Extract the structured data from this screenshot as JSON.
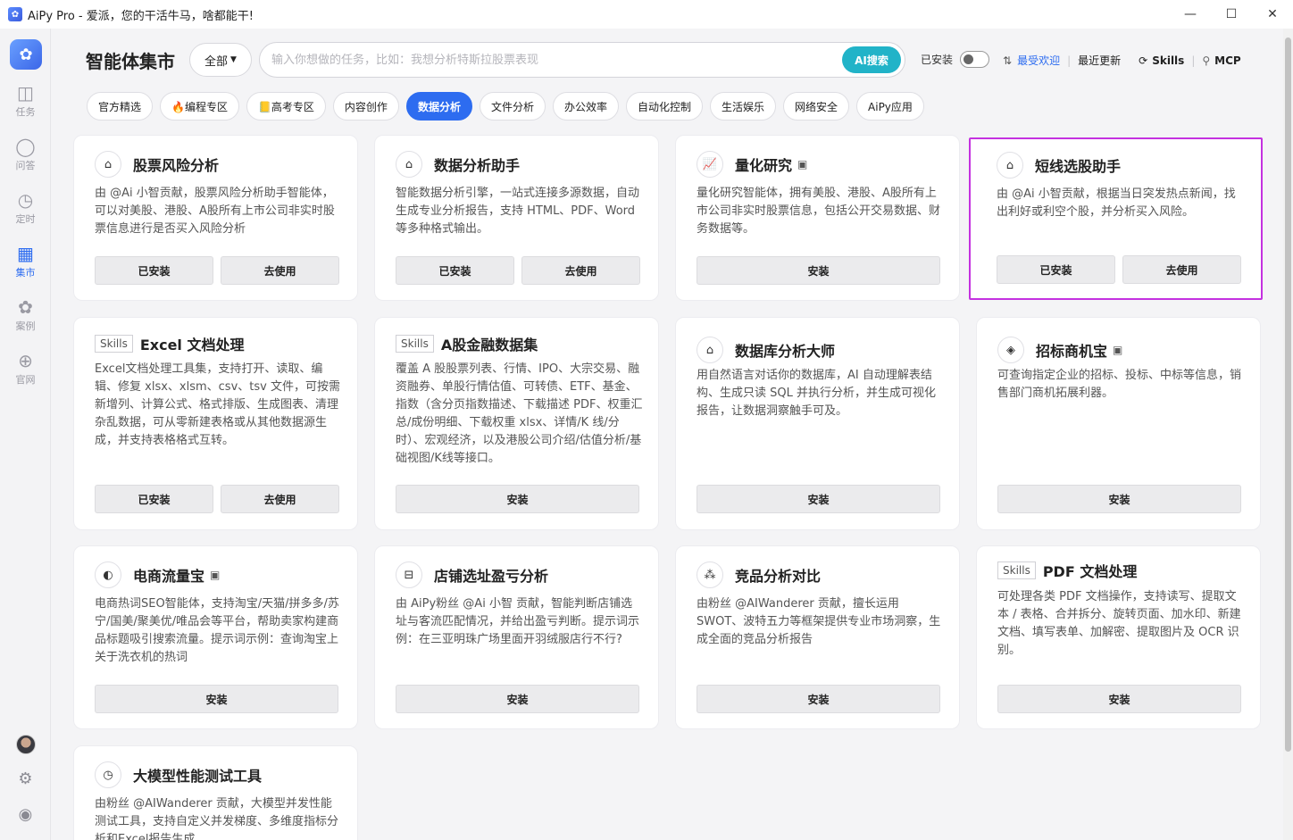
{
  "window": {
    "title": "AiPy Pro - 爱派，您的干活牛马，啥都能干!",
    "minimize": "—",
    "maximize": "☐",
    "close": "✕"
  },
  "sidebar": {
    "items": [
      {
        "label": "任务",
        "icon": "tasks-icon",
        "glyph": "◫"
      },
      {
        "label": "问答",
        "icon": "chat-icon",
        "glyph": "◯"
      },
      {
        "label": "定时",
        "icon": "schedule-icon",
        "glyph": "◷"
      },
      {
        "label": "集市",
        "icon": "market-icon",
        "glyph": "▦"
      },
      {
        "label": "案例",
        "icon": "cases-icon",
        "glyph": "✿"
      },
      {
        "label": "官网",
        "icon": "website-icon",
        "glyph": "⊕"
      }
    ],
    "settings_glyph": "⚙",
    "profile_glyph": "◉"
  },
  "header": {
    "title": "智能体集市",
    "filter_value": "全部",
    "search_placeholder": "输入你想做的任务，比如：我想分析特斯拉股票表现",
    "ai_search_label": "AI搜索",
    "installed_label": "已安装",
    "sort_popular": "最受欢迎",
    "sort_recent": "最近更新",
    "skills_label": "Skills",
    "mcp_label": "MCP"
  },
  "tabs": [
    "官方精选",
    "🔥编程专区",
    "📒高考专区",
    "内容创作",
    "数据分析",
    "文件分析",
    "办公效率",
    "自动化控制",
    "生活娱乐",
    "网络安全",
    "AiPy应用"
  ],
  "active_tab": "数据分析",
  "buttons": {
    "installed": "已安装",
    "use": "去使用",
    "install": "安装"
  },
  "skills_tag": "Skills",
  "cards": [
    {
      "title": "股票风险分析",
      "desc": "由 @Ai 小智贡献，股票风险分析助手智能体，可以对美股、港股、A股所有上市公司非实时股票信息进行是否买入风险分析",
      "icon_glyph": "⌂"
    },
    {
      "title": "数据分析助手",
      "desc": "智能数据分析引擎，一站式连接多源数据，自动生成专业分析报告，支持 HTML、PDF、Word 等多种格式输出。",
      "icon_glyph": "⌂"
    },
    {
      "title": "量化研究",
      "desc": "量化研究智能体，拥有美股、港股、A股所有上市公司非实时股票信息，包括公开交易数据、财务数据等。",
      "icon_glyph": "📈",
      "badge": "▣"
    },
    {
      "title": "短线选股助手",
      "desc": "由 @Ai 小智贡献，根据当日突发热点新闻，找出利好或利空个股，并分析买入风险。",
      "icon_glyph": "⌂"
    },
    {
      "title": "Excel 文档处理",
      "desc": "Excel文档处理工具集，支持打开、读取、编辑、修复 xlsx、xlsm、csv、tsv 文件，可按需新增列、计算公式、格式排版、生成图表、清理杂乱数据，可从零新建表格或从其他数据源生成，并支持表格格式互转。"
    },
    {
      "title": "A股金融数据集",
      "desc": "覆盖 A 股股票列表、行情、IPO、大宗交易、融资融券、单股行情估值、可转债、ETF、基金、指数（含分页指数描述、下载描述 PDF、权重汇总/成份明细、下载权重 xlsx、详情/K 线/分时）、宏观经济，以及港股公司介绍/估值分析/基础视图/K线等接口。"
    },
    {
      "title": "数据库分析大师",
      "desc": "用自然语言对话你的数据库，AI 自动理解表结构、生成只读 SQL 并执行分析，并生成可视化报告，让数据洞察触手可及。",
      "icon_glyph": "⌂"
    },
    {
      "title": "招标商机宝",
      "desc": "可查询指定企业的招标、投标、中标等信息，销售部门商机拓展利器。",
      "icon_glyph": "◈",
      "badge": "▣"
    },
    {
      "title": "电商流量宝",
      "desc": "电商热词SEO智能体，支持淘宝/天猫/拼多多/苏宁/国美/聚美优/唯品会等平台，帮助卖家构建商品标题吸引搜索流量。提示词示例：查询淘宝上关于洗衣机的热词",
      "icon_glyph": "◐",
      "badge": "▣"
    },
    {
      "title": "店铺选址盈亏分析",
      "desc": "由 AiPy粉丝 @Ai 小智 贡献，智能判断店铺选址与客流匹配情况，并给出盈亏判断。提示词示例：在三亚明珠广场里面开羽绒服店行不行?",
      "icon_glyph": "⊟"
    },
    {
      "title": "竞品分析对比",
      "desc": "由粉丝 @AIWanderer 贡献，擅长运用SWOT、波特五力等框架提供专业市场洞察，生成全面的竞品分析报告",
      "icon_glyph": "⁂"
    },
    {
      "title": "PDF 文档处理",
      "desc": "可处理各类 PDF 文档操作，支持读写、提取文本 / 表格、合并拆分、旋转页面、加水印、新建文档、填写表单、加解密、提取图片及 OCR 识别。"
    },
    {
      "title": "大模型性能测试工具",
      "desc": "由粉丝 @AIWanderer 贡献，大模型并发性能测试工具，支持自定义并发梯度、多维度指标分析和Excel报告生成",
      "icon_glyph": "◷"
    }
  ]
}
